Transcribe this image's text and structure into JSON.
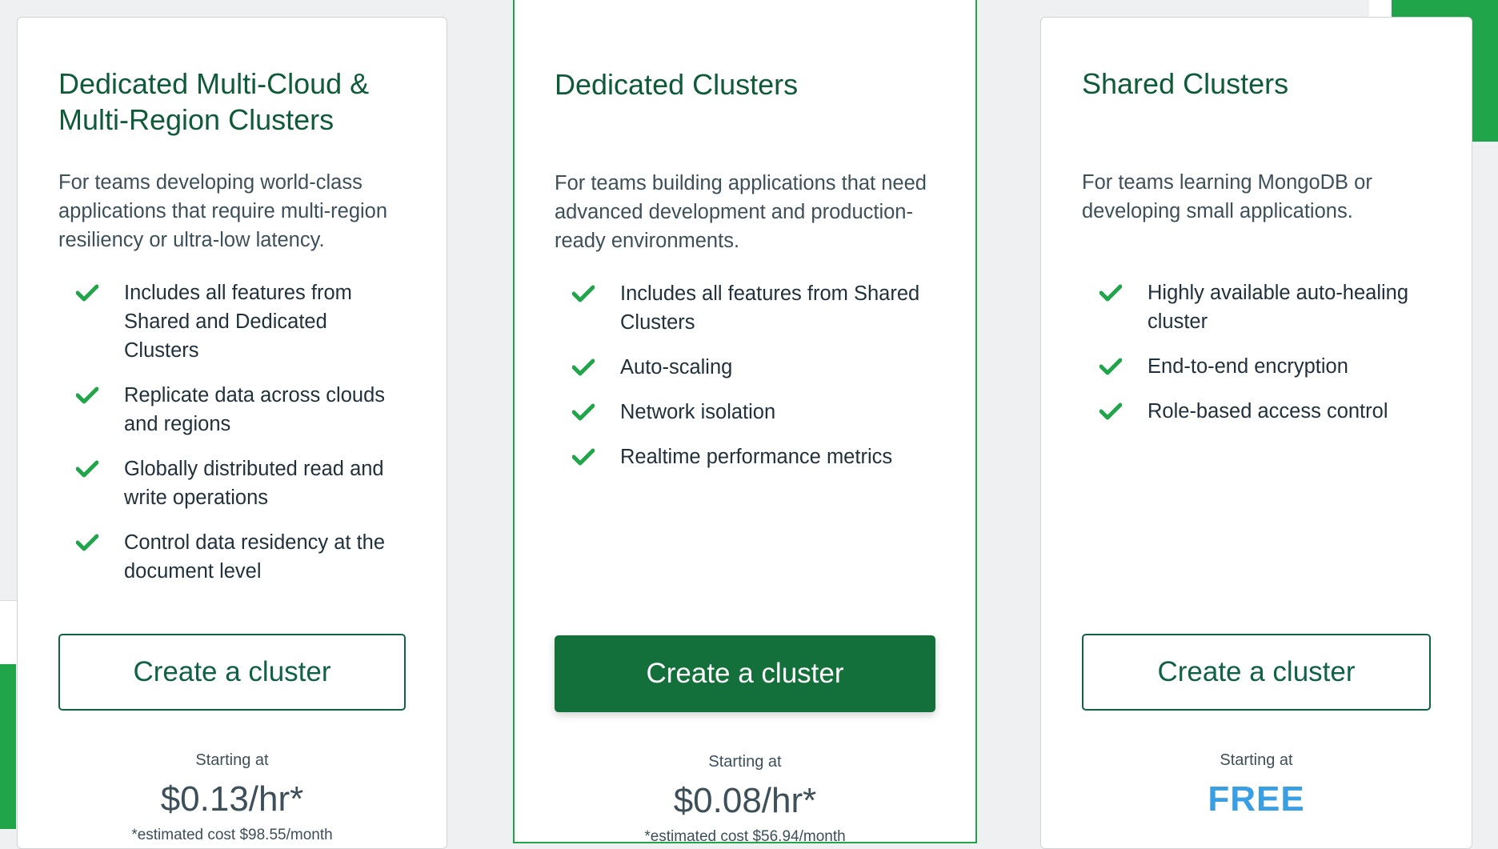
{
  "colors": {
    "brand_green": "#21a54a",
    "title_green": "#0f5a39",
    "button_green": "#13703a",
    "free_blue": "#3a9fe2"
  },
  "cards": [
    {
      "title": "Dedicated Multi-Cloud & Multi-Region Clusters",
      "description": "For teams developing world-class applications that require multi-region resiliency or ultra-low latency.",
      "features": [
        "Includes all features from Shared and Dedicated Clusters",
        "Replicate data across clouds and regions",
        "Globally distributed read and write operations",
        "Control data residency at the document level"
      ],
      "cta_label": "Create a cluster",
      "starting_label": "Starting at",
      "price": "$0.13/hr*",
      "estimate": "*estimated cost $98.55/month"
    },
    {
      "title": "Dedicated Clusters",
      "description": "For teams building applications that need advanced development and production-ready environments.",
      "features": [
        "Includes all features from Shared Clusters",
        "Auto-scaling",
        "Network isolation",
        "Realtime performance metrics"
      ],
      "cta_label": "Create a cluster",
      "starting_label": "Starting at",
      "price": "$0.08/hr*",
      "estimate": "*estimated cost $56.94/month"
    },
    {
      "title": "Shared Clusters",
      "description": "For teams learning MongoDB or developing small applications.",
      "features": [
        "Highly available auto-healing cluster",
        "End-to-end encryption",
        "Role-based access control"
      ],
      "cta_label": "Create a cluster",
      "starting_label": "Starting at",
      "price": "FREE"
    }
  ]
}
